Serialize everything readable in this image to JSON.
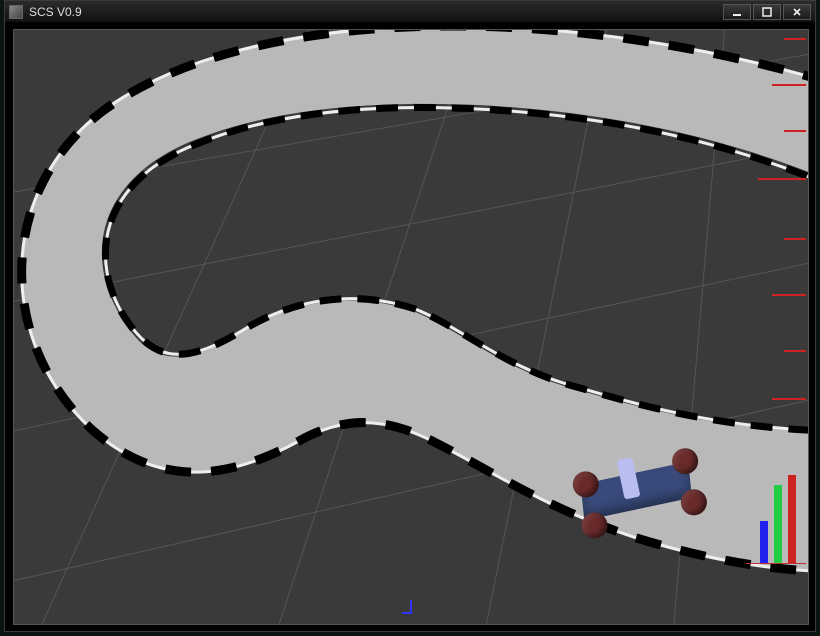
{
  "window": {
    "title": "SCS V0.9"
  },
  "hud": {
    "bar_colors": {
      "blue": "#22e",
      "green": "#2c4",
      "red": "#c22"
    }
  },
  "scene": {
    "ground_color": "#3a3a3a",
    "track_color": "#b9b9b9",
    "rumble_colors": [
      "#000000",
      "#ffffff"
    ]
  },
  "car": {
    "body_color": "#394a7a",
    "driver_color": "#b9bdf0",
    "wheel_color": "#6a2a2a"
  }
}
